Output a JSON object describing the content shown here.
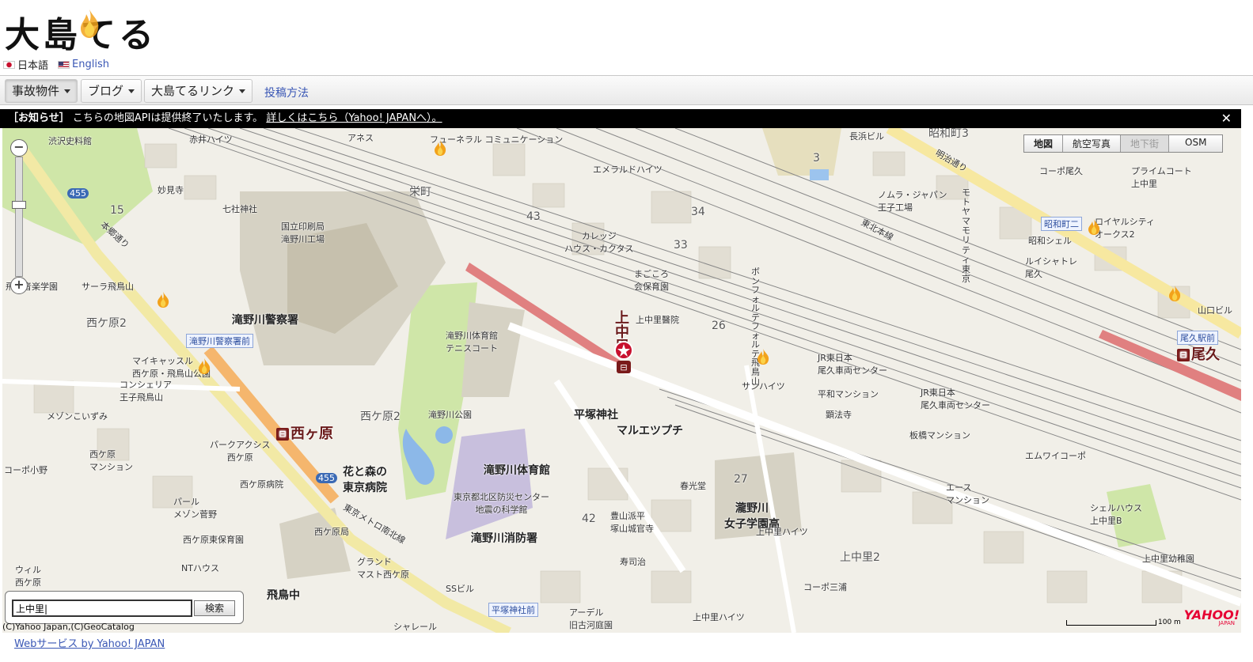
{
  "logo": {
    "text": "大島てる",
    "alt": "大島てる"
  },
  "languages": [
    {
      "label": "日本語",
      "flag": "jp-flag"
    },
    {
      "label": "English",
      "flag": "us-flag"
    }
  ],
  "nav": {
    "items": [
      {
        "label": "事故物件",
        "has_menu": true,
        "active": true
      },
      {
        "label": "ブログ",
        "has_menu": true
      },
      {
        "label": "大島てるリンク",
        "has_menu": true
      }
    ],
    "post_link": "投稿方法"
  },
  "notice": {
    "tag": "［お知らせ］",
    "text": "こちらの地図APIは提供終了いたします。",
    "link": "詳しくはこちら（Yahoo! JAPANへ）。",
    "close": "✕"
  },
  "map": {
    "types": [
      {
        "label": "地図",
        "selected": true
      },
      {
        "label": "航空写真"
      },
      {
        "label": "地下街",
        "disabled": true
      },
      {
        "label": "OSM"
      }
    ],
    "labels": {
      "shibusawa": "渋沢史料館",
      "akai": "赤井ハイツ",
      "anesu": "アネス",
      "fune": "フューネラル\nコミュニケーション",
      "emerald": "エメラルドハイツ",
      "nagahama": "長浜ビル",
      "showa3": "昭和町3",
      "meiji_dori": "明治通り",
      "corpo_oku": "コーポ尾久",
      "prime": "プライムコート\n上中里",
      "myoken": "妙見寺",
      "nanasha": "七社神社",
      "sakae": "栄町",
      "insatsu": "国立印刷局\n滝野川工場",
      "nomura": "ノムラ・ジャパン\n王子工場",
      "motoyama": "モトヤマ\nモリティ\n東京",
      "showamachi2": "昭和町二",
      "royal": "ロイヤルシティ\nオークス2",
      "showa_shell": "昭和シェル",
      "louis": "ルイシャトレ\n尾久",
      "tohoku": "東北本線",
      "college": "カレッジ\nハウス・カクタス",
      "magokoro": "まごころ\n会保育園",
      "ongaku": "飛鳥音楽学園",
      "sara": "サーラ飛鳥山",
      "hongo": "本郷通り",
      "keisatsu": "滝野川警察署",
      "keisatsu_mae": "滝野川警察署前",
      "nishigahara2": "西ケ原2",
      "mycastle": "マイキャッスル\n西ケ原・飛鳥山公園",
      "concierge": "コンシェリア\n王子飛鳥山",
      "maison": "メゾンこいずみ",
      "tennis": "滝野川体育館\nテニスコート",
      "park": "滝野川公園",
      "nishigahara2b": "西ケ原2",
      "nishigahara_sta": "西ヶ原",
      "hiratsuka": "平塚神社",
      "marue": "マルエツプチ",
      "kaminakasato_sta": "上中里",
      "kaminakasato_dr": "上中里醫院",
      "bonfort": "ボンフォルテ\nフォルテ飛鳥山",
      "jr_center1": "JR東日本\n尾久車両センター",
      "jr_center2": "JR東日本\n尾久車両センター",
      "sunheights": "サンハイツ",
      "heiwa": "平和マンション",
      "kensho": "顕法寺",
      "itabashi": "板橋マンション",
      "emwai": "エムワイコーポ",
      "oku_eki": "尾久駅前",
      "oku_sta": "尾久",
      "yamaguchi": "山口ビル",
      "park_akusu": "パークアクシス\n西ケ原",
      "hanamori": "花と森の\n東京病院",
      "taiikukan": "滝野川体育館",
      "bousai": "東京都北区防災センター\n地震の科学館",
      "shoubou": "滝野川消防署",
      "shunko": "春光堂",
      "toyoyama": "豊山派平\n塚山城官寺",
      "jogakuen": "瀧野川\n女子学園高",
      "kami_heights": "上中里ハイツ",
      "ace": "エース\nマンション",
      "shellhouse": "シェルハウス\n上中里B",
      "youchien": "上中里幼稚園",
      "kaminakasato2": "上中里2",
      "corpo_miura": "コーポ三浦",
      "nishigahara_hosp": "西ケ原病院",
      "pearl": "パール\nメゾン菅野",
      "nishigahara_hoiku": "西ケ原東保育園",
      "nt": "NTハウス",
      "nishigahara_kyoku": "西ケ原局",
      "grand": "グランド\nマスト西ケ原",
      "asukachu": "飛鳥中",
      "ss": "SSビル",
      "juju": "寿司治",
      "nanboku": "東京メトロ南北線",
      "hiratsuka_mae": "平塚神社前",
      "arden": "アーデル\n旧古河庭園",
      "kami_heights2": "上中里ハイツ",
      "shirel": "シャレール",
      "corpo_ogura": "コーポ小野",
      "mansion_nishi": "西ケ原\nマンション",
      "n_3": "3",
      "n_15": "15",
      "n_34": "34",
      "n_33": "33",
      "n_43": "43",
      "n_26": "26",
      "n_27": "27",
      "n_42": "42",
      "n_455": "455",
      "n_455b": "455",
      "wire": "ウィル\n西ケ原"
    },
    "search": {
      "value": "上中里|",
      "button": "検索"
    },
    "copyright": "(C)Yahoo Japan,(C)GeoCatalog",
    "yahoo_logo": "YAHOO!",
    "yahoo_sub": "JAPAN",
    "scale": "100 m"
  },
  "footer_link": "Webサービス by Yahoo! JAPAN",
  "colors": {
    "rail": "#888888",
    "platform": "#e08080",
    "main_road": "#f7e8a0",
    "route_road": "#f5b66d",
    "park": "#cfe6a8",
    "facility": "#d6d2c4",
    "purple_block": "#c8bfdd"
  }
}
